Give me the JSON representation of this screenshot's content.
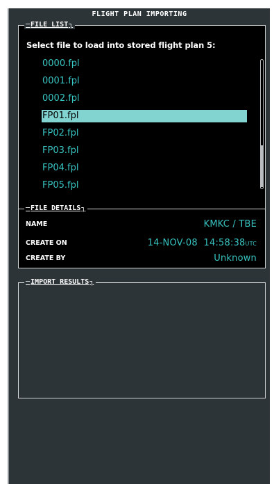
{
  "window": {
    "title": "FLIGHT PLAN IMPORTING"
  },
  "file_list": {
    "legend": "FILE LIST",
    "prompt": "Select file to load into stored flight plan 5:",
    "items": [
      {
        "name": "0000.fpl",
        "selected": false
      },
      {
        "name": "0001.fpl",
        "selected": false
      },
      {
        "name": "0002.fpl",
        "selected": false
      },
      {
        "name": "FP01.fpl",
        "selected": true
      },
      {
        "name": "FP02.fpl",
        "selected": false
      },
      {
        "name": "FP03.fpl",
        "selected": false
      },
      {
        "name": "FP04.fpl",
        "selected": false
      },
      {
        "name": "FP05.fpl",
        "selected": false
      }
    ]
  },
  "file_details": {
    "legend": "FILE DETAILS",
    "name_label": "NAME",
    "name_value": "KMKC / TBE",
    "created_on_label": "CREATE ON",
    "created_on_date": "14-NOV-08",
    "created_on_time": "14:58:38",
    "created_on_tz": "UTC",
    "created_by_label": "CREATE BY",
    "created_by_value": "Unknown"
  },
  "import_results": {
    "legend": "IMPORT RESULTS"
  },
  "colors": {
    "panel": "#2d3437",
    "text_cyan": "#38c4c1",
    "selection": "#81d4d0"
  }
}
